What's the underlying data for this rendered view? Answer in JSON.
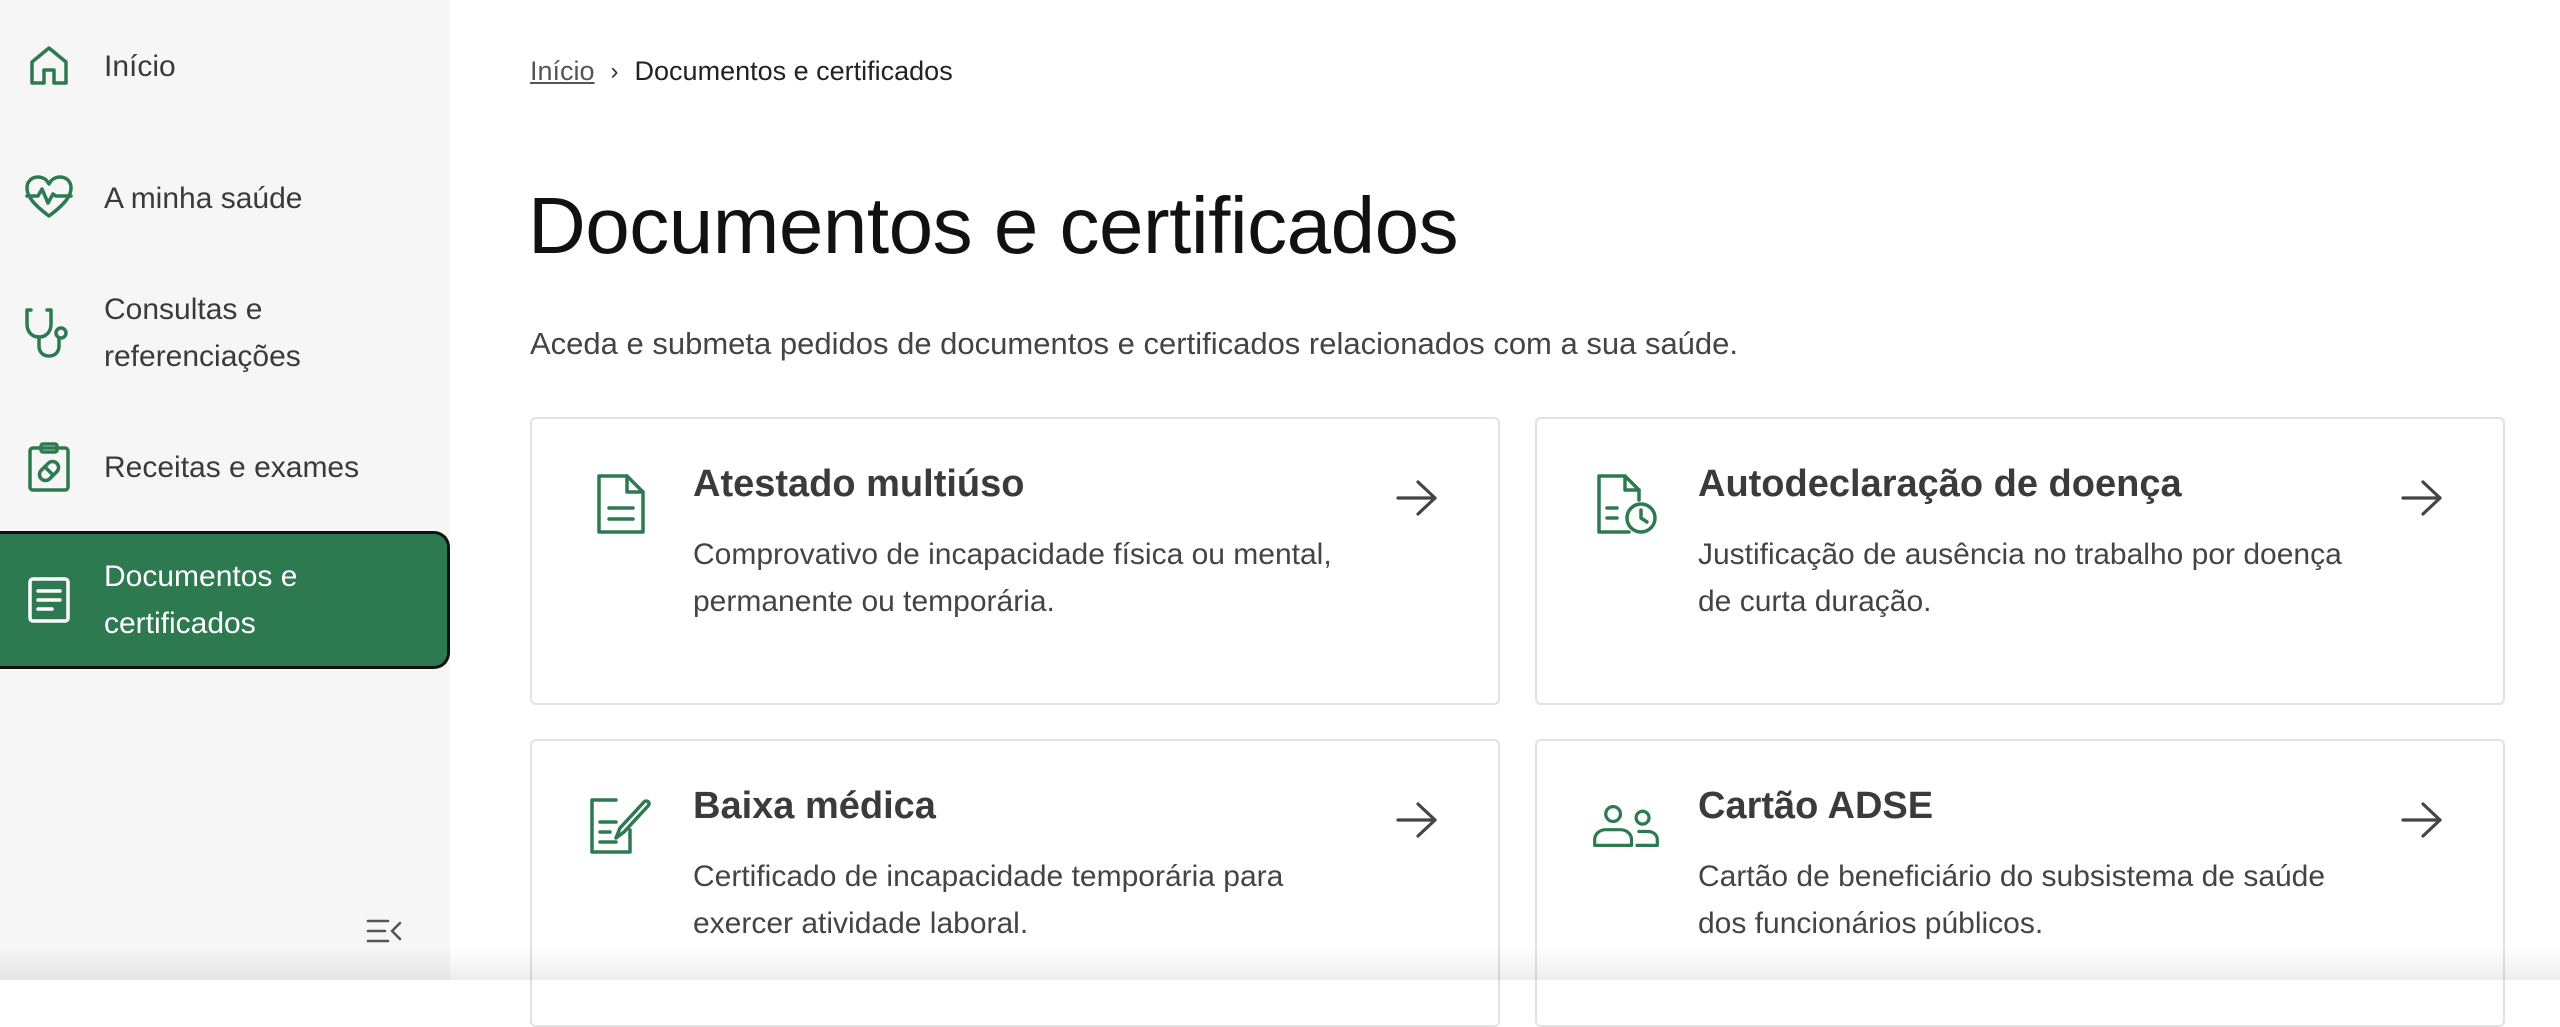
{
  "sidebar": {
    "items": [
      {
        "label": "Início",
        "icon": "home-icon"
      },
      {
        "label": "A minha saúde",
        "icon": "heart-pulse-icon"
      },
      {
        "label": "Consultas e referenciações",
        "icon": "stethoscope-icon"
      },
      {
        "label": "Receitas e exames",
        "icon": "clipboard-pill-icon"
      },
      {
        "label": "Documentos e certificados",
        "icon": "document-icon",
        "active": true
      }
    ],
    "collapse_icon": "collapse-menu-icon"
  },
  "breadcrumb": {
    "home": "Início",
    "separator": "›",
    "current": "Documentos e certificados"
  },
  "page": {
    "title": "Documentos e certificados",
    "intro": "Aceda e submeta pedidos de documentos e certificados relacionados com a sua saúde."
  },
  "cards": [
    {
      "title": "Atestado multiúso",
      "description": "Comprovativo de incapacidade física ou mental, permanente ou temporária.",
      "icon": "document-icon"
    },
    {
      "title": "Autodeclaração de doença",
      "description": "Justificação de ausência no trabalho por doença de curta duração.",
      "icon": "document-clock-icon"
    },
    {
      "title": "Baixa médica",
      "description": "Certificado de incapacidade temporária para exercer atividade laboral.",
      "icon": "document-pen-icon"
    },
    {
      "title": "Cartão ADSE",
      "description": "Cartão de beneficiário do subsistema de saúde dos funcionários públicos.",
      "icon": "people-icon"
    }
  ],
  "colors": {
    "accent": "#2d7a51",
    "icon": "#2d7a51",
    "text": "#222222"
  }
}
